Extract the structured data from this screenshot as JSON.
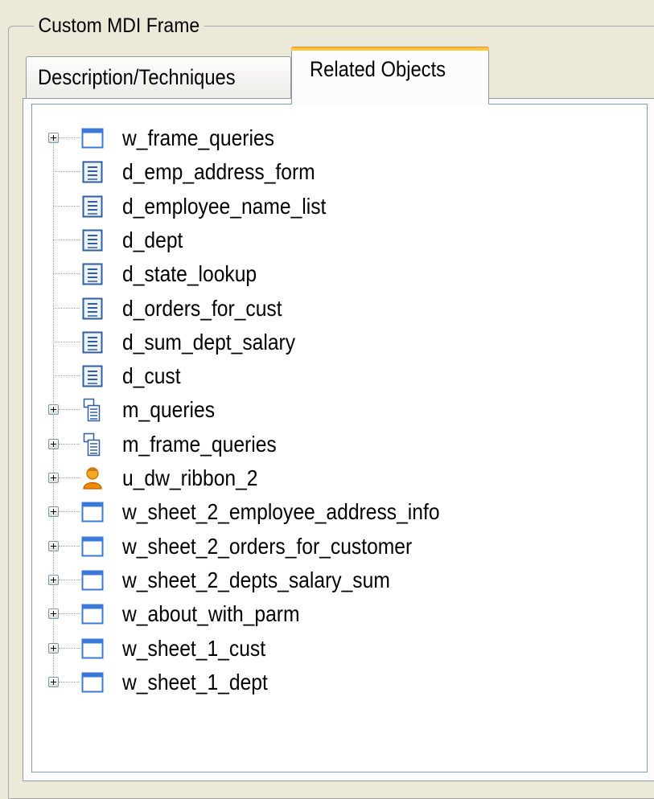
{
  "group": {
    "title": "Custom MDI Frame"
  },
  "tabs": [
    {
      "label": "Description/Techniques",
      "active": false
    },
    {
      "label": "Related Objects",
      "active": true
    }
  ],
  "tree": {
    "items": [
      {
        "label": "w_frame_queries",
        "icon": "window-icon",
        "expandable": true
      },
      {
        "label": "d_emp_address_form",
        "icon": "datawindow-icon",
        "expandable": false
      },
      {
        "label": "d_employee_name_list",
        "icon": "datawindow-icon",
        "expandable": false
      },
      {
        "label": "d_dept",
        "icon": "datawindow-icon",
        "expandable": false
      },
      {
        "label": "d_state_lookup",
        "icon": "datawindow-icon",
        "expandable": false
      },
      {
        "label": "d_orders_for_cust",
        "icon": "datawindow-icon",
        "expandable": false
      },
      {
        "label": "d_sum_dept_salary",
        "icon": "datawindow-icon",
        "expandable": false
      },
      {
        "label": "d_cust",
        "icon": "datawindow-icon",
        "expandable": false
      },
      {
        "label": "m_queries",
        "icon": "menu-icon",
        "expandable": true
      },
      {
        "label": "m_frame_queries",
        "icon": "menu-icon",
        "expandable": true
      },
      {
        "label": "u_dw_ribbon_2",
        "icon": "user-object-icon",
        "expandable": true
      },
      {
        "label": "w_sheet_2_employee_address_info",
        "icon": "window-icon",
        "expandable": true
      },
      {
        "label": "w_sheet_2_orders_for_customer",
        "icon": "window-icon",
        "expandable": true
      },
      {
        "label": "w_sheet_2_depts_salary_sum",
        "icon": "window-icon",
        "expandable": true
      },
      {
        "label": "w_about_with_parm",
        "icon": "window-icon",
        "expandable": true
      },
      {
        "label": "w_sheet_1_cust",
        "icon": "window-icon",
        "expandable": true
      },
      {
        "label": "w_sheet_1_dept",
        "icon": "window-icon",
        "expandable": true
      }
    ]
  },
  "colors": {
    "background": "#ece9d8",
    "active_tab_highlight": "#ffc83c",
    "tree_border": "#7f9db9",
    "window_icon_title": "#3c78d8"
  }
}
